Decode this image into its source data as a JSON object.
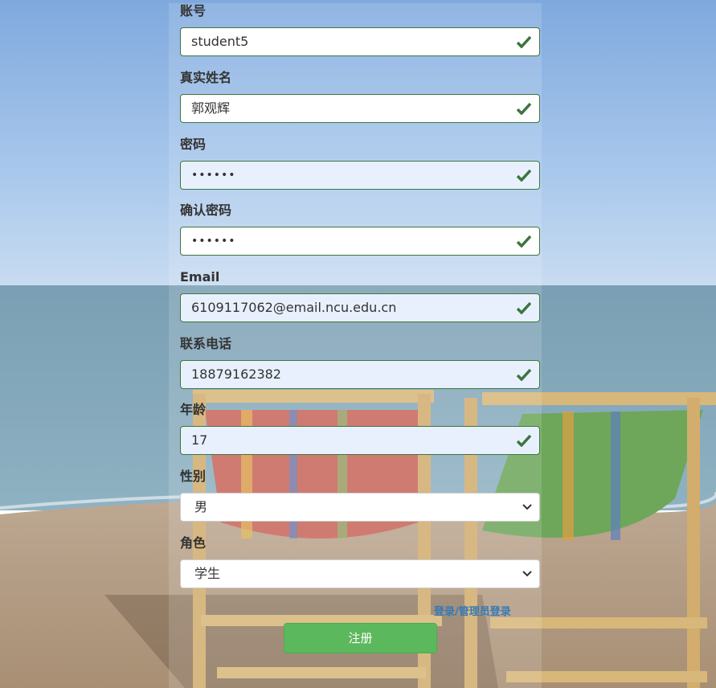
{
  "form": {
    "fields": [
      {
        "label": "账号",
        "value": "student5",
        "autofill": false,
        "password": false
      },
      {
        "label": "真实姓名",
        "value": "郭观辉",
        "autofill": false,
        "password": false
      },
      {
        "label": "密码",
        "value": "••••••",
        "autofill": true,
        "password": true
      },
      {
        "label": "确认密码",
        "value": "••••••",
        "autofill": false,
        "password": true
      },
      {
        "label": "Email",
        "value": "6109117062@email.ncu.edu.cn",
        "autofill": true,
        "password": false
      },
      {
        "label": "联系电话",
        "value": "18879162382",
        "autofill": true,
        "password": false
      },
      {
        "label": "年龄",
        "value": "17",
        "autofill": true,
        "password": false
      }
    ],
    "gender": {
      "label": "性别",
      "selected": "男"
    },
    "role": {
      "label": "角色",
      "selected": "学生"
    },
    "links": {
      "login": "登录",
      "separator": "/",
      "admin_login": "管理员登录"
    },
    "submit_label": "注册"
  },
  "colors": {
    "valid_border": "#3c763d",
    "valid_icon": "#3c763d",
    "submit_bg": "#5cb85c",
    "link": "#337ab7",
    "autofill_bg": "#e8f0fe"
  },
  "icons": {
    "valid": "check-icon",
    "select": "chevron-down-icon"
  }
}
